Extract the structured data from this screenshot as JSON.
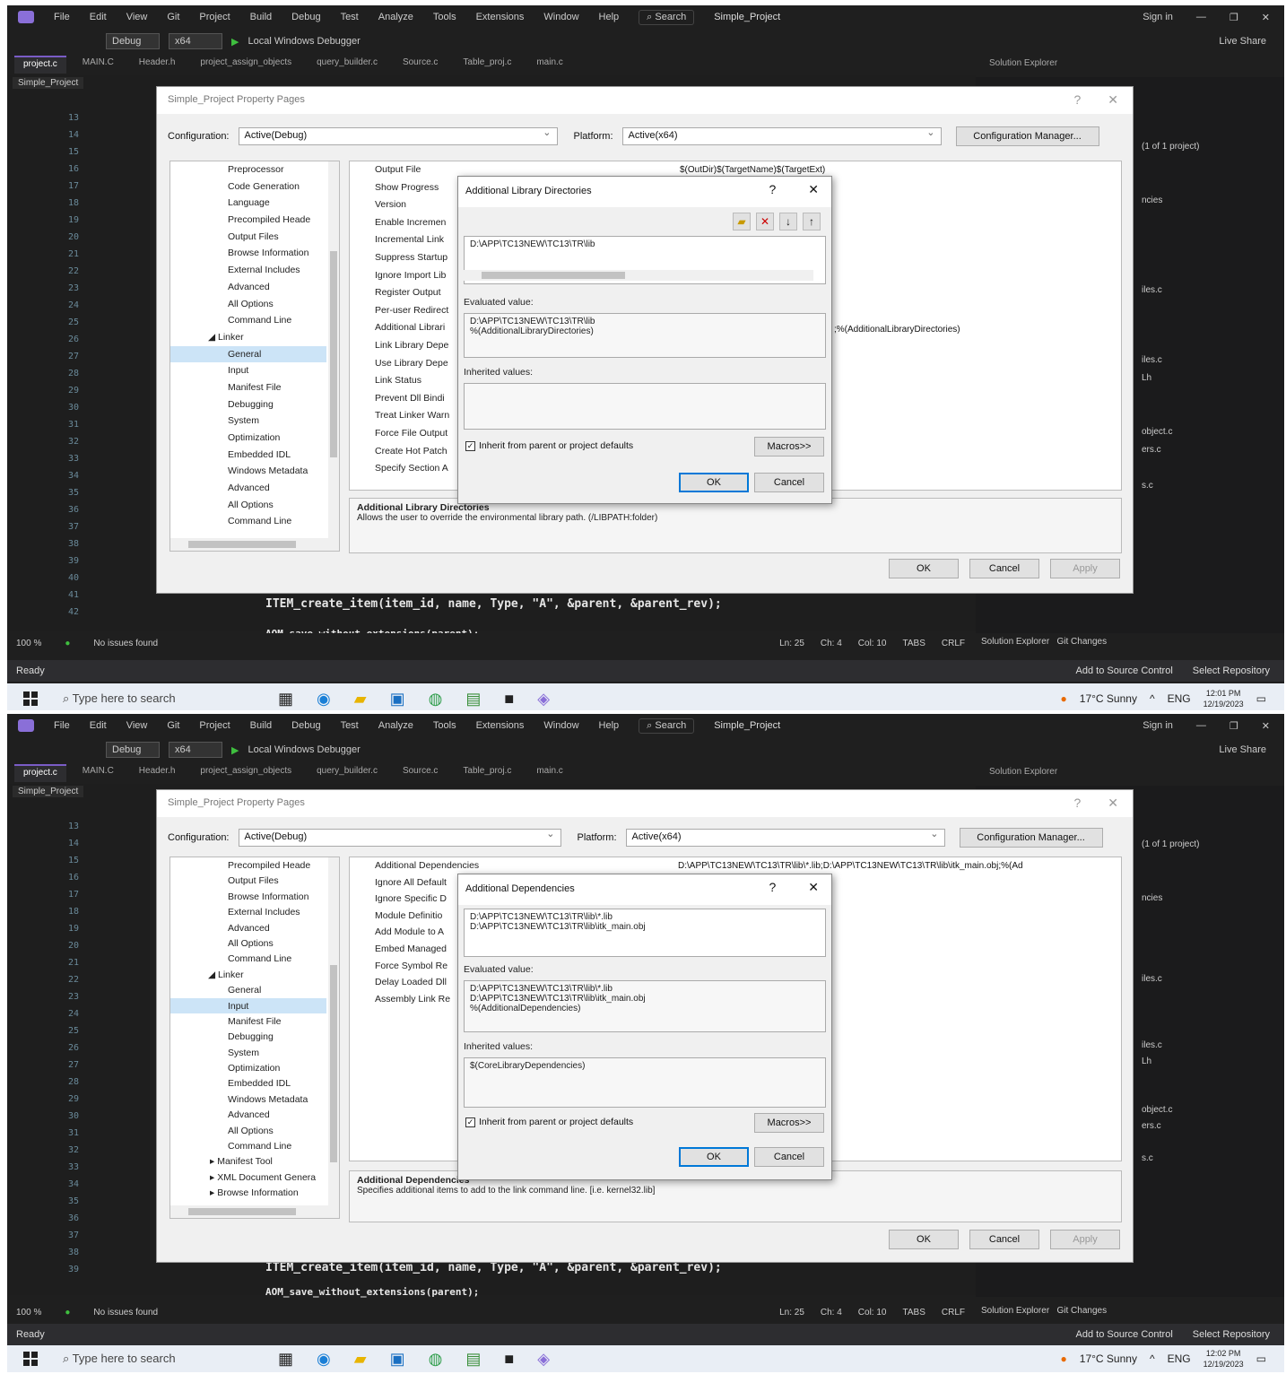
{
  "menu": {
    "items": [
      "File",
      "Edit",
      "View",
      "Git",
      "Project",
      "Build",
      "Debug",
      "Test",
      "Analyze",
      "Tools",
      "Extensions",
      "Window",
      "Help"
    ],
    "search": "Search",
    "project_name": "Simple_Project",
    "signin": "Sign in"
  },
  "toolbar": {
    "config": "Debug",
    "platform": "x64",
    "debugger": "Local Windows Debugger",
    "live_share": "Live Share"
  },
  "editor": {
    "tabs": [
      "project.c",
      "MAIN.C",
      "Header.h",
      "project_assign_objects",
      "query_builder.c",
      "Source.c",
      "Table_proj.c",
      "main.c"
    ],
    "solution_header": "Solution Explorer",
    "project_label": "Simple_Project",
    "line_numbers": [
      "13",
      "14",
      "15",
      "16",
      "17",
      "18",
      "19",
      "20",
      "21",
      "22",
      "23",
      "24",
      "25",
      "26",
      "27",
      "28",
      "29",
      "30",
      "31",
      "32",
      "33",
      "34",
      "35",
      "36",
      "37",
      "38",
      "39",
      "40",
      "41",
      "42"
    ],
    "code_line_1": "ITEM_create_item(item_id, name, Type, \"A\", &parent, &parent_rev);",
    "code_line_2": "AOM_save_without_extensions(parent);",
    "solution_items": [
      "(1 of 1 project)",
      "ncies",
      "iles.c",
      "iles.c",
      "Lh",
      "object.c",
      "ers.c",
      "s.c"
    ]
  },
  "editor_status": {
    "zoom": "100 %",
    "issues": "No issues found",
    "ln": "Ln: 25",
    "ch": "Ch: 4",
    "col": "Col: 10",
    "tabs": "TABS",
    "crlf": "CRLF",
    "solution_explorer": "Solution Explorer",
    "git_changes": "Git Changes"
  },
  "statusbar": {
    "ready": "Ready",
    "add_source": "Add to Source Control",
    "select_repo": "Select Repository"
  },
  "taskbar": {
    "search_placeholder": "Type here to search",
    "weather": "17°C  Sunny",
    "lang": "ENG",
    "time_1": "12:01 PM",
    "date_1": "12/19/2023",
    "time_2": "12:02 PM",
    "date_2": "12/19/2023"
  },
  "property_pages": {
    "title": "Simple_Project Property Pages",
    "configuration_label": "Configuration:",
    "configuration_value": "Active(Debug)",
    "platform_label": "Platform:",
    "platform_value": "Active(x64)",
    "config_manager": "Configuration Manager...",
    "ok": "OK",
    "cancel": "Cancel",
    "apply": "Apply"
  },
  "panel1": {
    "tree": [
      "Preprocessor",
      "Code Generation",
      "Language",
      "Precompiled Heade",
      "Output Files",
      "Browse Information",
      "External Includes",
      "Advanced",
      "All Options",
      "Command Line",
      "Linker",
      "General",
      "Input",
      "Manifest File",
      "Debugging",
      "System",
      "Optimization",
      "Embedded IDL",
      "Windows Metadata",
      "Advanced",
      "All Options",
      "Command Line"
    ],
    "properties": [
      "Output File",
      "Show Progress",
      "Version",
      "Enable Incremen",
      "Incremental Link",
      "Suppress Startup",
      "Ignore Import Lib",
      "Register Output",
      "Per-user Redirect",
      "Additional Librari",
      "Link Library Depe",
      "Use Library Depe",
      "Link Status",
      "Prevent Dll Bindi",
      "Treat Linker Warn",
      "Force File Output",
      "Create Hot Patch",
      "Specify Section A"
    ],
    "output_file_value": "$(OutDir)$(TargetName)$(TargetExt)",
    "additional_lib_value": ";%(AdditionalLibraryDirectories)",
    "desc_title": "Additional Library Directories",
    "desc_text": "Allows the user to override the environmental library path. (/LIBPATH:folder)",
    "dialog": {
      "title": "Additional Library Directories",
      "entry": "D:\\APP\\TC13NEW\\TC13\\TR\\lib",
      "evaluated_label": "Evaluated value:",
      "evaluated_1": "D:\\APP\\TC13NEW\\TC13\\TR\\lib",
      "evaluated_2": "%(AdditionalLibraryDirectories)",
      "inherited_label": "Inherited values:",
      "inherited_value": "",
      "inherit_check": "Inherit from parent or project defaults",
      "macros": "Macros>>",
      "ok": "OK",
      "cancel": "Cancel"
    }
  },
  "panel2": {
    "tree": [
      "Precompiled Heade",
      "Output Files",
      "Browse Information",
      "External Includes",
      "Advanced",
      "All Options",
      "Command Line",
      "Linker",
      "General",
      "Input",
      "Manifest File",
      "Debugging",
      "System",
      "Optimization",
      "Embedded IDL",
      "Windows Metadata",
      "Advanced",
      "All Options",
      "Command Line",
      "Manifest Tool",
      "XML Document Genera",
      "Browse Information"
    ],
    "properties": [
      "Additional Dependencies",
      "Ignore All Default",
      "Ignore Specific D",
      "Module Definitio",
      "Add Module to A",
      "Embed Managed",
      "Force Symbol Re",
      "Delay Loaded Dll",
      "Assembly Link Re"
    ],
    "additional_dep_value": "D:\\APP\\TC13NEW\\TC13\\TR\\lib\\*.lib;D:\\APP\\TC13NEW\\TC13\\TR\\lib\\itk_main.obj;%(Ad",
    "desc_title": "Additional Dependencies",
    "desc_text": "Specifies additional items to add to the link command line. [i.e. kernel32.lib]",
    "dialog": {
      "title": "Additional Dependencies",
      "entry_1": "D:\\APP\\TC13NEW\\TC13\\TR\\lib\\*.lib",
      "entry_2": "D:\\APP\\TC13NEW\\TC13\\TR\\lib\\itk_main.obj",
      "evaluated_label": "Evaluated value:",
      "evaluated_1": "D:\\APP\\TC13NEW\\TC13\\TR\\lib\\*.lib",
      "evaluated_2": "D:\\APP\\TC13NEW\\TC13\\TR\\lib\\itk_main.obj",
      "evaluated_3": "%(AdditionalDependencies)",
      "inherited_label": "Inherited values:",
      "inherited_value": "$(CoreLibraryDependencies)",
      "inherit_check": "Inherit from parent or project defaults",
      "macros": "Macros>>",
      "ok": "OK",
      "cancel": "Cancel"
    }
  }
}
